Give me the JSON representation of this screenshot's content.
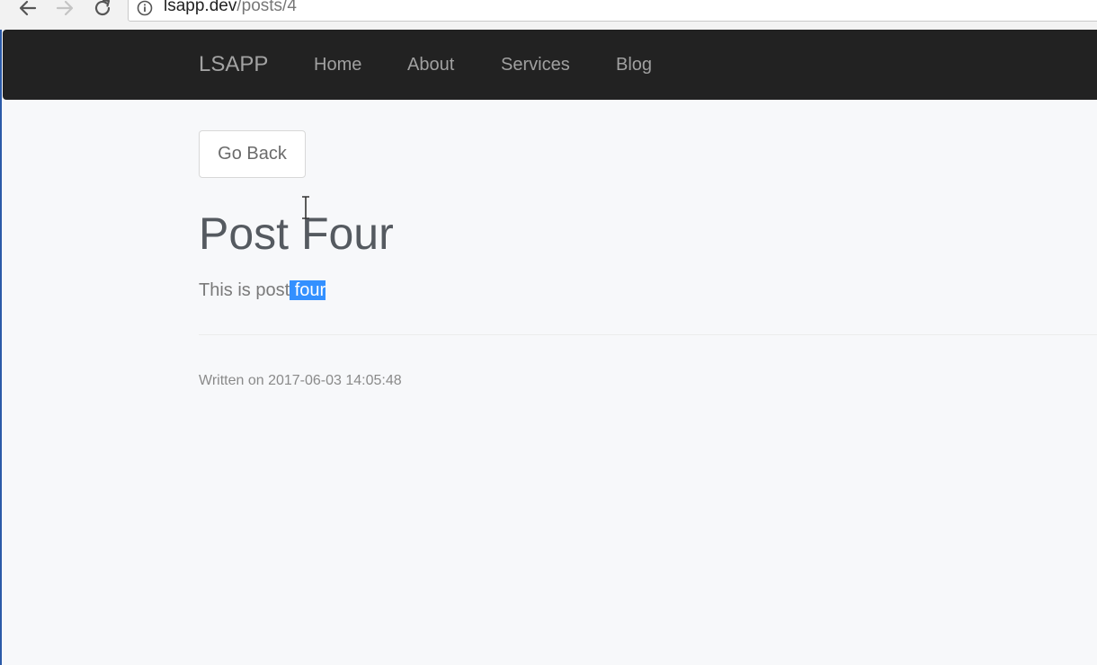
{
  "browser": {
    "url_host": "lsapp.dev",
    "url_path": "/posts/4",
    "icons": [
      "back-arrow-icon",
      "forward-arrow-icon",
      "reload-icon",
      "info-icon"
    ]
  },
  "navbar": {
    "brand": "LSAPP",
    "links": [
      {
        "label": "Home"
      },
      {
        "label": "About"
      },
      {
        "label": "Services"
      },
      {
        "label": "Blog"
      }
    ]
  },
  "post": {
    "go_back_label": "Go Back",
    "title": "Post Four",
    "body_prefix": "This is post",
    "body_selected": " four",
    "written_on": "Written on 2017-06-03 14:05:48"
  },
  "colors": {
    "navbar_bg": "#222222",
    "page_bg": "#f7f8fa",
    "selection": "#3390ff"
  }
}
